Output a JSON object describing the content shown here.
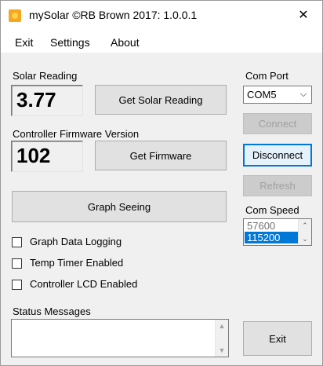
{
  "window": {
    "title": "mySolar ©RB Brown 2017: 1.0.0.1"
  },
  "menu": {
    "exit": "Exit",
    "settings": "Settings",
    "about": "About"
  },
  "solar": {
    "label": "Solar Reading",
    "value": "3.77",
    "button": "Get Solar Reading"
  },
  "firmware": {
    "label": "Controller Firmware Version",
    "value": "102",
    "button": "Get Firmware"
  },
  "graph": {
    "button": "Graph Seeing"
  },
  "options": {
    "graph_logging": "Graph Data Logging",
    "temp_timer": "Temp Timer Enabled",
    "lcd_enabled": "Controller LCD Enabled"
  },
  "status": {
    "label": "Status Messages",
    "value": ""
  },
  "comport": {
    "label": "Com Port",
    "selected": "COM5",
    "connect": "Connect",
    "disconnect": "Disconnect",
    "refresh": "Refresh"
  },
  "comspeed": {
    "label": "Com Speed",
    "items": [
      "57600",
      "115200"
    ],
    "selected_index": 1
  },
  "exit_button": "Exit"
}
